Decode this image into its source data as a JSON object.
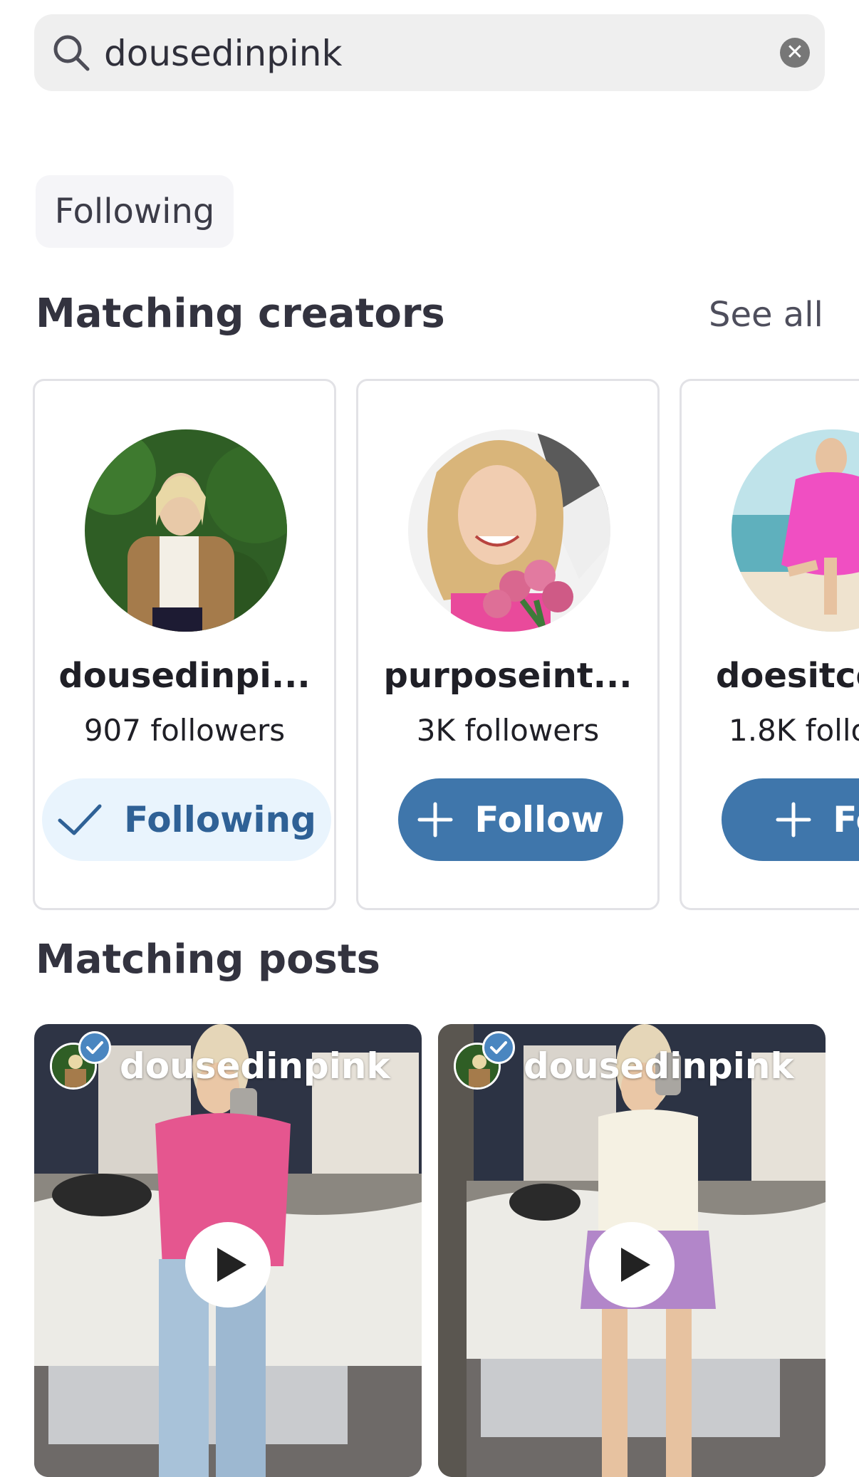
{
  "search": {
    "query": "dousedinpink"
  },
  "filter_chip": {
    "label": "Following"
  },
  "creators_section": {
    "title": "Matching creators",
    "see_all": "See all"
  },
  "creators": [
    {
      "name": "dousedinpi...",
      "followers": "907 followers",
      "button": "Following"
    },
    {
      "name": "purposeint...",
      "followers": "3K followers",
      "button": "Follow"
    },
    {
      "name": "doesitco",
      "followers": "1.8K follo",
      "button": "Fol"
    }
  ],
  "posts_section": {
    "title": "Matching posts"
  },
  "posts": [
    {
      "username": "dousedinpink"
    },
    {
      "username": "dousedinpink"
    }
  ],
  "colors": {
    "accent_blue": "#3f76ab",
    "following_bg": "#e9f4fd",
    "following_text": "#2f6196"
  },
  "icons": [
    "search-icon",
    "clear-icon",
    "check-icon",
    "plus-icon",
    "verified-icon",
    "play-icon"
  ]
}
